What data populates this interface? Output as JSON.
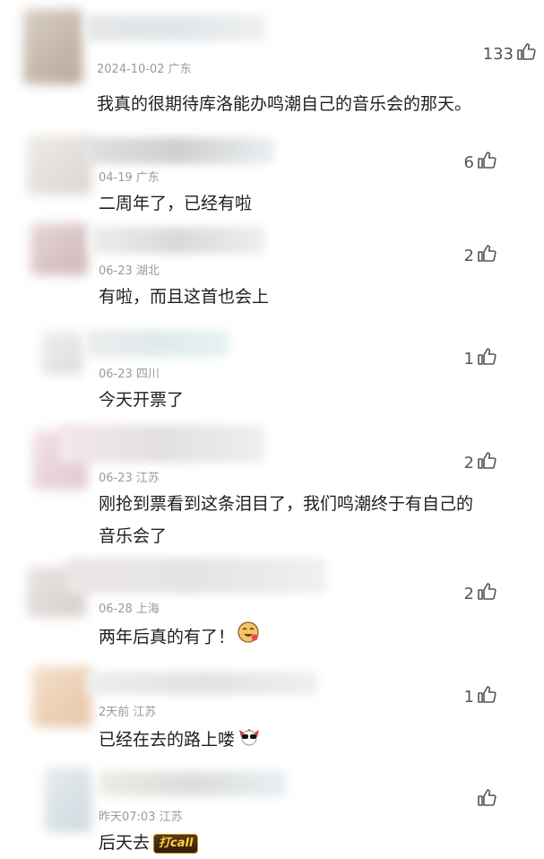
{
  "comments": [
    {
      "meta": "2024-10-02 广东",
      "text": "我真的很期待库洛能办鸣潮自己的音乐会的那天。",
      "likes": "133"
    },
    {
      "meta": "04-19 广东",
      "text": "二周年了，已经有啦",
      "likes": "6"
    },
    {
      "meta": "06-23 湖北",
      "text": "有啦，而且这首也会上",
      "likes": "2"
    },
    {
      "meta": "06-23 四川",
      "text": "今天开票了",
      "likes": "1"
    },
    {
      "meta": "06-23 江苏",
      "text": "刚抢到票看到这条泪目了，我们鸣潮终于有自己的音乐会了",
      "likes": "2"
    },
    {
      "meta": "06-28 上海",
      "text": "两年后真的有了！",
      "likes": "2"
    },
    {
      "meta": "2天前 江苏",
      "text": "已经在去的路上喽",
      "likes": "1"
    },
    {
      "meta": "昨天07:03 江苏",
      "text": "后天去",
      "likes": "",
      "sticker": "打call"
    }
  ],
  "icons": {
    "like": "thumbs-up-icon"
  },
  "colors": {
    "meta": "#9a9a9a",
    "text": "#1f1f1f",
    "icon": "#555555"
  }
}
